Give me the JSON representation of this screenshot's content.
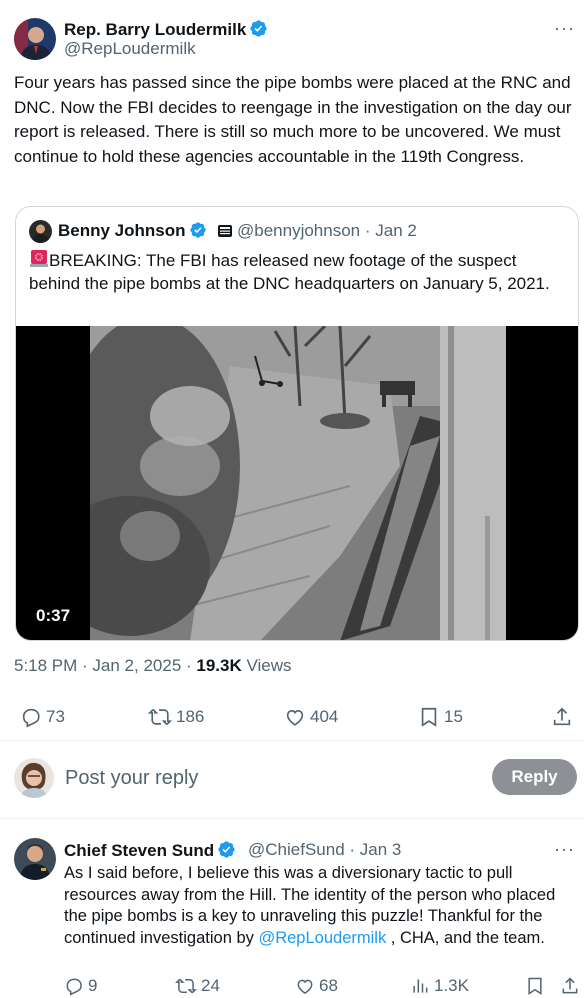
{
  "tweet": {
    "author_name": "Rep. Barry Loudermilk",
    "author_handle": "@RepLoudermilk",
    "more": "···",
    "text": "Four years has passed since the pipe bombs were placed at the RNC and DNC. Now the FBI decides to reengage in the investigation on the day our report is released. There is still so much more to be uncovered. We must continue to hold these agencies accountable in the 119th Congress.",
    "timestamp": "5:18 PM · Jan 2, 2025 · ",
    "views_count": "19.3K",
    "views_label": " Views",
    "actions": {
      "replies": "73",
      "reposts": "186",
      "likes": "404",
      "bookmarks": "15"
    }
  },
  "quoted": {
    "author_name": "Benny Johnson",
    "author_handle": "@bennyjohnson",
    "date": " · Jan 2",
    "text": "BREAKING: The FBI has released new footage of the suspect behind the pipe bombs at the DNC headquarters on January 5, 2021.",
    "video_duration": "0:37"
  },
  "reply_box": {
    "placeholder": "Post your reply",
    "button_label": "Reply"
  },
  "reply": {
    "author_name": "Chief Steven Sund",
    "author_handle": "@ChiefSund",
    "date": " · Jan 3",
    "more": "···",
    "text_before": "As I said before, I believe this was a diversionary tactic to pull resources away from the Hill. The identity of the person who placed the pipe bombs is a key to unraveling this puzzle! Thankful for the continued investigation by ",
    "mention": "@RepLoudermilk",
    "text_after": " , CHA, and the team.",
    "actions": {
      "replies": "9",
      "reposts": "24",
      "likes": "68",
      "views": "1.3K"
    }
  },
  "colors": {
    "verified": "#1d9bf0",
    "link": "#1d9bf0",
    "muted": "#536471",
    "reply_button": "#8d9196"
  },
  "icons": [
    "verified-badge-icon",
    "more-icon",
    "reply-icon",
    "repost-icon",
    "like-icon",
    "bookmark-icon",
    "share-icon",
    "views-icon",
    "siren-icon",
    "affiliate-badge-icon"
  ]
}
